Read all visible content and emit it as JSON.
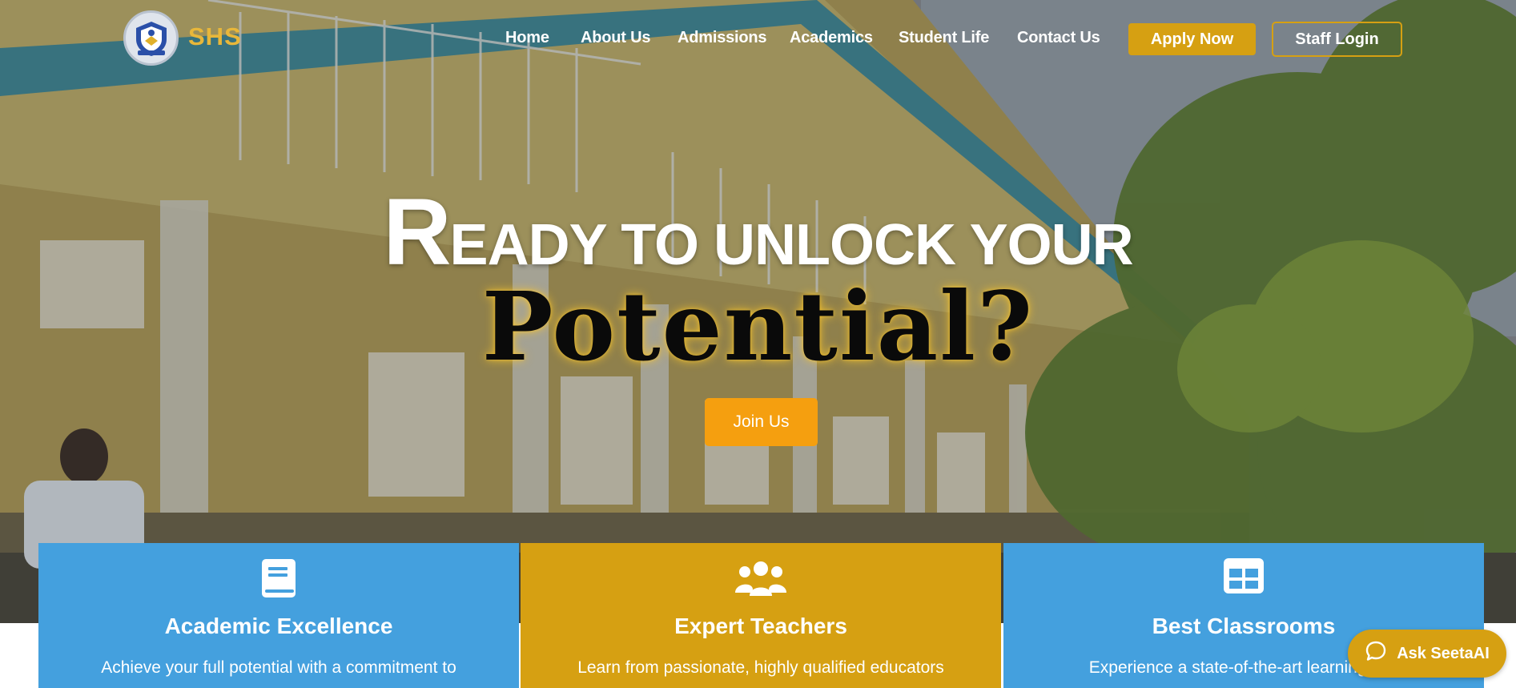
{
  "brand": {
    "name": "SHS",
    "logo_icon": "school-crest-icon"
  },
  "nav": {
    "items": [
      {
        "label": "Home"
      },
      {
        "label": "About Us"
      },
      {
        "label": "Admissions"
      },
      {
        "label": "Academics"
      },
      {
        "label": "Student Life"
      },
      {
        "label": "Contact Us"
      }
    ],
    "apply_label": "Apply Now",
    "staff_label": "Staff Login"
  },
  "hero": {
    "headline_cap": "R",
    "headline_rest": "EADY TO UNLOCK YOUR",
    "headline_accent": "Potential?",
    "cta_label": "Join Us"
  },
  "features": [
    {
      "icon": "book-icon",
      "title": "Academic Excellence",
      "description": "Achieve your full potential with a commitment to"
    },
    {
      "icon": "users-icon",
      "title": "Expert Teachers",
      "description": "Learn from passionate, highly qualified educators"
    },
    {
      "icon": "classroom-grid-icon",
      "title": "Best Classrooms",
      "description": "Experience a state-of-the-art learning env"
    }
  ],
  "chat": {
    "label": "Ask SeetaAI",
    "icon": "chat-bubble-icon"
  },
  "colors": {
    "gold": "#d6a012",
    "orange": "#f59f0f",
    "blue": "#44a0de",
    "white": "#ffffff"
  }
}
